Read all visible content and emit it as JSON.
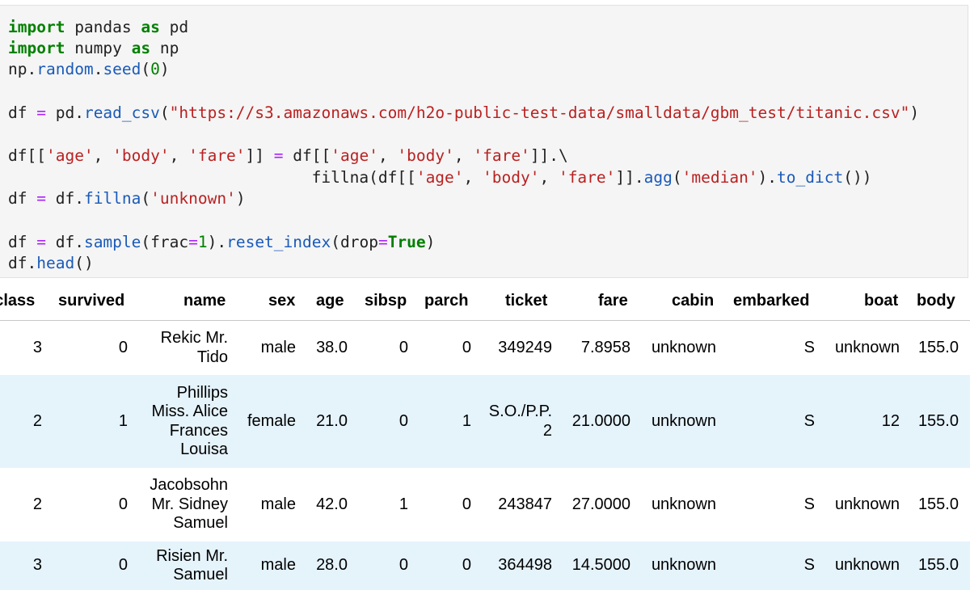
{
  "code": {
    "line1": {
      "kw1": "import",
      "t1": " pandas ",
      "kw2": "as",
      "t2": " pd"
    },
    "line2": {
      "kw1": "import",
      "t1": " numpy ",
      "kw2": "as",
      "t2": " np"
    },
    "line3": {
      "t1": "np.",
      "fn1": "random",
      "t2": ".",
      "fn2": "seed",
      "t3": "(",
      "num": "0",
      "t4": ")"
    },
    "line4": {
      "t1": "df ",
      "op": "=",
      "t2": " pd.",
      "fn": "read_csv",
      "t3": "(",
      "str": "\"https://s3.amazonaws.com/h2o-public-test-data/smalldata/gbm_test/titanic.csv\"",
      "t4": ")"
    },
    "line5": {
      "t1": "df[[",
      "s1": "'age'",
      "t2": ", ",
      "s2": "'body'",
      "t3": ", ",
      "s3": "'fare'",
      "t4": "]] ",
      "op": "=",
      "t5": " df[[",
      "s4": "'age'",
      "t6": ", ",
      "s5": "'body'",
      "t7": ", ",
      "s6": "'fare'",
      "t8": "]].\\"
    },
    "line6": {
      "t1": "                                fillna(df[[",
      "s1": "'age'",
      "t2": ", ",
      "s2": "'body'",
      "t3": ", ",
      "s3": "'fare'",
      "t4": "]].",
      "fn1": "agg",
      "t5": "(",
      "s4": "'median'",
      "t6": ").",
      "fn2": "to_dict",
      "t7": "())"
    },
    "line7": {
      "t1": "df ",
      "op": "=",
      "t2": " df.",
      "fn": "fillna",
      "t3": "(",
      "str": "'unknown'",
      "t4": ")"
    },
    "line8": {
      "t1": "df ",
      "op": "=",
      "t2": " df.",
      "fn1": "sample",
      "t3": "(frac",
      "op2": "=",
      "num": "1",
      "t4": ").",
      "fn2": "reset_index",
      "t5": "(drop",
      "op3": "=",
      "tr": "True",
      "t6": ")"
    },
    "line9": {
      "t1": "df.",
      "fn": "head",
      "t2": "()"
    }
  },
  "table": {
    "headers": [
      "pclass",
      "survived",
      "name",
      "sex",
      "age",
      "sibsp",
      "parch",
      "ticket",
      "fare",
      "cabin",
      "embarked",
      "boat",
      "body"
    ],
    "rows": [
      {
        "pclass": "3",
        "survived": "0",
        "name": [
          "Rekic Mr.",
          "Tido"
        ],
        "sex": "male",
        "age": "38.0",
        "sibsp": "0",
        "parch": "0",
        "ticket": [
          "349249"
        ],
        "fare": "7.8958",
        "cabin": "unknown",
        "embarked": "S",
        "boat": "unknown",
        "body": "155.0"
      },
      {
        "pclass": "2",
        "survived": "1",
        "name": [
          "Phillips",
          "Miss. Alice",
          "Frances",
          "Louisa"
        ],
        "sex": "female",
        "age": "21.0",
        "sibsp": "0",
        "parch": "1",
        "ticket": [
          "S.O./P.P.",
          "2"
        ],
        "fare": "21.0000",
        "cabin": "unknown",
        "embarked": "S",
        "boat": "12",
        "body": "155.0"
      },
      {
        "pclass": "2",
        "survived": "0",
        "name": [
          "Jacobsohn",
          "Mr. Sidney",
          "Samuel"
        ],
        "sex": "male",
        "age": "42.0",
        "sibsp": "1",
        "parch": "0",
        "ticket": [
          "243847"
        ],
        "fare": "27.0000",
        "cabin": "unknown",
        "embarked": "S",
        "boat": "unknown",
        "body": "155.0"
      },
      {
        "pclass": "3",
        "survived": "0",
        "name": [
          "Risien Mr.",
          "Samuel"
        ],
        "sex": "male",
        "age": "28.0",
        "sibsp": "0",
        "parch": "0",
        "ticket": [
          "364498"
        ],
        "fare": "14.5000",
        "cabin": "unknown",
        "embarked": "S",
        "boat": "unknown",
        "body": "155.0"
      }
    ]
  },
  "colors": {
    "code_bg": "#f5f5f5",
    "keyword": "#008000",
    "function": "#1a5ab8",
    "string": "#ba2121",
    "operator": "#aa22ff",
    "row_highlight": "#e5f3fb"
  }
}
